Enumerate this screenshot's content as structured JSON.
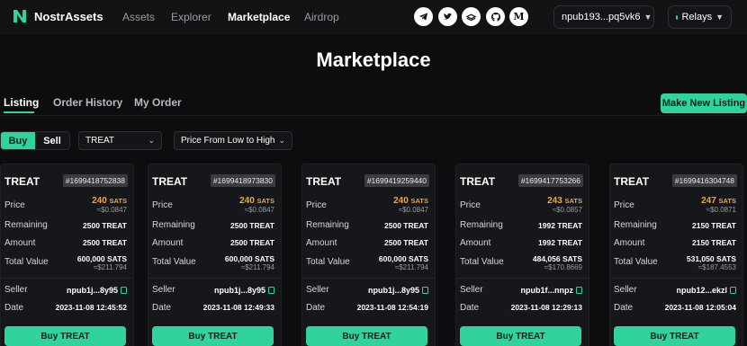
{
  "colors": {
    "accent": "#30d39b",
    "price": "#f3a53a",
    "background": "#0d0d0f"
  },
  "header": {
    "logo_text": "NostrAssets",
    "nav": [
      "Assets",
      "Explorer",
      "Marketplace",
      "Airdrop"
    ],
    "active_nav": "Marketplace",
    "social_icons": [
      "telegram-icon",
      "twitter-icon",
      "gitbook-icon",
      "github-icon",
      "medium-icon"
    ],
    "account": "npub193...pq5vk6",
    "relays": "Relays"
  },
  "page": {
    "title": "Marketplace"
  },
  "tabs": [
    "Listing",
    "Order History",
    "My Order"
  ],
  "actions": {
    "make_listing": "Make New Listing"
  },
  "filters": {
    "buy": "Buy",
    "sell": "Sell",
    "token": "TREAT",
    "sort": "Price From Low to High"
  },
  "labels": {
    "price": "Price",
    "remaining": "Remaining",
    "amount": "Amount",
    "total_value": "Total Value",
    "seller": "Seller",
    "date": "Date"
  },
  "listings": [
    {
      "token": "TREAT",
      "id": "#1699418752838",
      "price": "240",
      "unit": "SATS",
      "price_usd": "≈$0.0847",
      "remaining": "2500 TREAT",
      "amount": "2500 TREAT",
      "total": "600,000 SATS",
      "total_usd": "≈$211.794",
      "seller": "npub1j...8y95",
      "date": "2023-11-08 12:45:52",
      "buy_label": "Buy TREAT"
    },
    {
      "token": "TREAT",
      "id": "#1699418973830",
      "price": "240",
      "unit": "SATS",
      "price_usd": "≈$0.0847",
      "remaining": "2500 TREAT",
      "amount": "2500 TREAT",
      "total": "600,000 SATS",
      "total_usd": "≈$211.794",
      "seller": "npub1j...8y95",
      "date": "2023-11-08 12:49:33",
      "buy_label": "Buy TREAT"
    },
    {
      "token": "TREAT",
      "id": "#1699419259440",
      "price": "240",
      "unit": "SATS",
      "price_usd": "≈$0.0847",
      "remaining": "2500 TREAT",
      "amount": "2500 TREAT",
      "total": "600,000 SATS",
      "total_usd": "≈$211.794",
      "seller": "npub1j...8y95",
      "date": "2023-11-08 12:54:19",
      "buy_label": "Buy TREAT"
    },
    {
      "token": "TREAT",
      "id": "#1699417753266",
      "price": "243",
      "unit": "SATS",
      "price_usd": "≈$0.0857",
      "remaining": "1992 TREAT",
      "amount": "1992 TREAT",
      "total": "484,056 SATS",
      "total_usd": "≈$170.8669",
      "seller": "npub1f...nnpz",
      "date": "2023-11-08 12:29:13",
      "buy_label": "Buy TREAT"
    },
    {
      "token": "TREAT",
      "id": "#1699416304748",
      "price": "247",
      "unit": "SATS",
      "price_usd": "≈$0.0871",
      "remaining": "2150 TREAT",
      "amount": "2150 TREAT",
      "total": "531,050 SATS",
      "total_usd": "≈$187.4553",
      "seller": "npub12...ekzl",
      "date": "2023-11-08 12:05:04",
      "buy_label": "Buy TREAT"
    }
  ]
}
